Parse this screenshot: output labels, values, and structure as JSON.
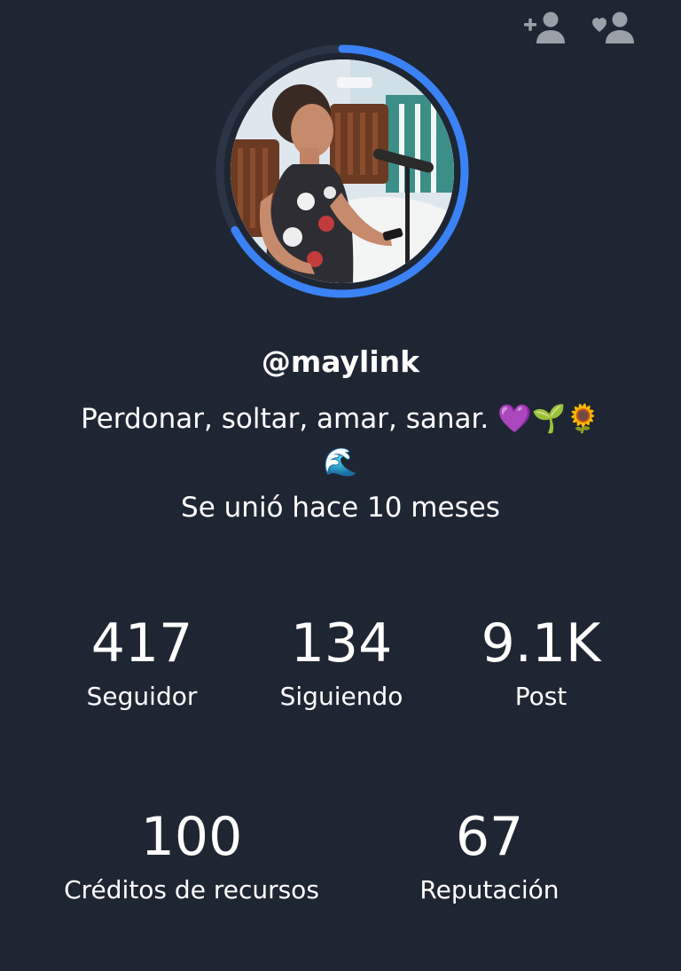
{
  "profile": {
    "username": "@maylink",
    "bio": "Perdonar, soltar, amar, sanar. 💜🌱🌻🌊",
    "joined": "Se unió hace 10 meses"
  },
  "stats": {
    "followers": {
      "value": "417",
      "label": "Seguidor"
    },
    "following": {
      "value": "134",
      "label": "Siguiendo"
    },
    "posts": {
      "value": "9.1K",
      "label": "Post"
    },
    "credits": {
      "value": "100",
      "label": "Créditos de recursos"
    },
    "reputation": {
      "value": "67",
      "label": "Reputación"
    }
  },
  "header": {
    "icons": [
      "add-user-icon",
      "follow-heart-user-icon"
    ]
  },
  "colors": {
    "background": "#1f2633",
    "accent": "#3b82f6",
    "icon_gray": "#9aa0a8"
  },
  "avatar": {
    "ring_progress": 0.67
  }
}
